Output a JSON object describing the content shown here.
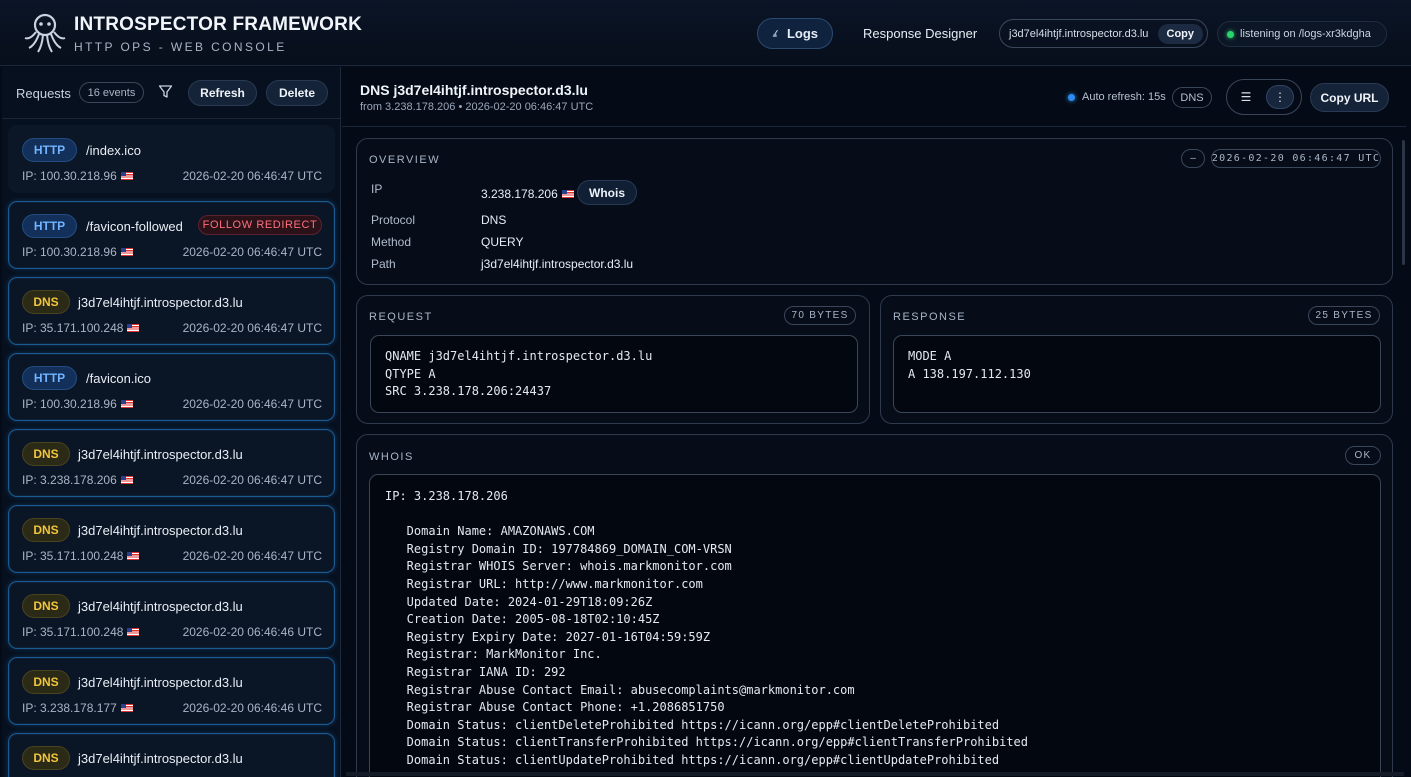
{
  "app": {
    "title": "INTROSPECTOR FRAMEWORK",
    "subtitle": "HTTP OPS - WEB CONSOLE"
  },
  "nav": {
    "logs": "Logs",
    "designer": "Response Designer",
    "host": "j3d7el4ihtjf.introspector.d3.lu",
    "copy": "Copy",
    "listening": "listening on /logs-xr3kdgha"
  },
  "requests": {
    "title": "Requests",
    "count": "16 events",
    "refresh": "Refresh",
    "delete": "Delete",
    "items": [
      {
        "type": "HTTP",
        "path": "/index.ico",
        "ip": "IP: 100.30.218.96",
        "time": "2026-02-20 06:46:47 UTC",
        "tag": ""
      },
      {
        "type": "HTTP",
        "path": "/favicon-followed",
        "ip": "IP: 100.30.218.96",
        "time": "2026-02-20 06:46:47 UTC",
        "tag": "FOLLOW REDIRECT"
      },
      {
        "type": "DNS",
        "path": "j3d7el4ihtjf.introspector.d3.lu",
        "ip": "IP: 35.171.100.248",
        "time": "2026-02-20 06:46:47 UTC",
        "tag": ""
      },
      {
        "type": "HTTP",
        "path": "/favicon.ico",
        "ip": "IP: 100.30.218.96",
        "time": "2026-02-20 06:46:47 UTC",
        "tag": ""
      },
      {
        "type": "DNS",
        "path": "j3d7el4ihtjf.introspector.d3.lu",
        "ip": "IP: 3.238.178.206",
        "time": "2026-02-20 06:46:47 UTC",
        "tag": ""
      },
      {
        "type": "DNS",
        "path": "j3d7el4ihtjf.introspector.d3.lu",
        "ip": "IP: 35.171.100.248",
        "time": "2026-02-20 06:46:47 UTC",
        "tag": ""
      },
      {
        "type": "DNS",
        "path": "j3d7el4ihtjf.introspector.d3.lu",
        "ip": "IP: 35.171.100.248",
        "time": "2026-02-20 06:46:46 UTC",
        "tag": ""
      },
      {
        "type": "DNS",
        "path": "j3d7el4ihtjf.introspector.d3.lu",
        "ip": "IP: 3.238.178.177",
        "time": "2026-02-20 06:46:46 UTC",
        "tag": ""
      },
      {
        "type": "DNS",
        "path": "j3d7el4ihtjf.introspector.d3.lu",
        "ip": "",
        "time": "",
        "tag": ""
      }
    ]
  },
  "detail": {
    "title": "DNS j3d7el4ihtjf.introspector.d3.lu",
    "sub": "from 3.238.178.206 • 2026-02-20 06:46:47 UTC",
    "auto_refresh": "Auto refresh: 15s",
    "proto_tag": "DNS",
    "view_list": "☰",
    "view_more": "⋮",
    "copy_url": "Copy URL"
  },
  "overview": {
    "label": "OVERVIEW",
    "collapse": "–",
    "timestamp": "2026-02-20 06:46:47 UTC",
    "ip_key": "IP",
    "ip_val": "3.238.178.206",
    "whois_btn": "Whois",
    "protocol_key": "Protocol",
    "protocol_val": "DNS",
    "method_key": "Method",
    "method_val": "QUERY",
    "path_key": "Path",
    "path_val": "j3d7el4ihtjf.introspector.d3.lu"
  },
  "request": {
    "label": "REQUEST",
    "bytes": "70 BYTES",
    "body": "QNAME j3d7el4ihtjf.introspector.d3.lu\nQTYPE A\nSRC 3.238.178.206:24437"
  },
  "response": {
    "label": "RESPONSE",
    "bytes": "25 BYTES",
    "body": "MODE A\nA 138.197.112.130"
  },
  "whois": {
    "label": "WHOIS",
    "status": "OK",
    "body": "IP: 3.238.178.206\n\n   Domain Name: AMAZONAWS.COM\n   Registry Domain ID: 197784869_DOMAIN_COM-VRSN\n   Registrar WHOIS Server: whois.markmonitor.com\n   Registrar URL: http://www.markmonitor.com\n   Updated Date: 2024-01-29T18:09:26Z\n   Creation Date: 2005-08-18T02:10:45Z\n   Registry Expiry Date: 2027-01-16T04:59:59Z\n   Registrar: MarkMonitor Inc.\n   Registrar IANA ID: 292\n   Registrar Abuse Contact Email: abusecomplaints@markmonitor.com\n   Registrar Abuse Contact Phone: +1.2086851750\n   Domain Status: clientDeleteProhibited https://icann.org/epp#clientDeleteProhibited\n   Domain Status: clientTransferProhibited https://icann.org/epp#clientTransferProhibited\n   Domain Status: clientUpdateProhibited https://icann.org/epp#clientUpdateProhibited"
  },
  "colors": {
    "accent": "#2e8cf0",
    "http_badge": "#72b4ff",
    "dns_badge": "#f2c53d",
    "redirect": "#ff6f7d",
    "online": "#2bd36b"
  }
}
